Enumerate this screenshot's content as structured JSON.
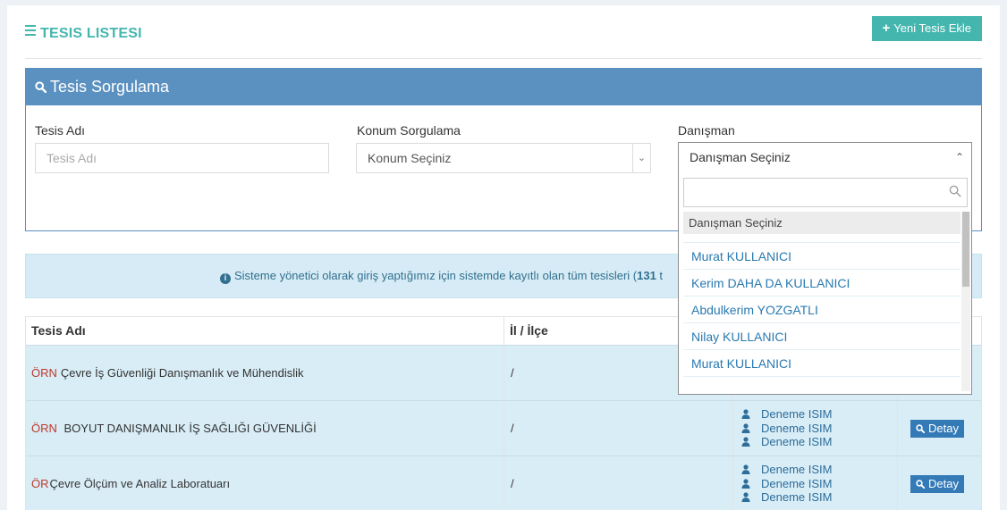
{
  "header": {
    "title": "TESIS LISTESI",
    "add_button": "Yeni Tesis Ekle"
  },
  "search_panel": {
    "title": "Tesis Sorgulama",
    "facility_name_label": "Tesis Adı",
    "facility_name_placeholder": "Tesis Adı",
    "location_label": "Konum Sorgulama",
    "location_value": "Konum Seçiniz",
    "consultant_label": "Danışman",
    "consultant_value": "Danışman Seçiniz"
  },
  "consultant_dropdown": {
    "selected_option": "Danışman Seçiniz",
    "options": [
      "Murat KULLANICI",
      "Kerim DAHA DA KULLANICI",
      "Abdulkerim YOZGATLI",
      "Nilay KULLANICI",
      "Murat KULLANICI"
    ]
  },
  "alert": {
    "text_before": "Sisteme yönetici olarak giriş yaptığımız için sistemde kayıtlı olan tüm tesisleri (",
    "count": "131",
    "text_after": " t"
  },
  "table": {
    "headers": [
      "Tesis Adı",
      "İl / İlçe",
      "",
      ""
    ],
    "rows": [
      {
        "code": "ÖRN",
        "name": "Çevre İş Güvenliği Danışmanlık ve Mühendislik",
        "location": "/",
        "consultants": [],
        "detail": ""
      },
      {
        "code": "ÖRN",
        "name": " BOYUT DANIŞMANLIK İŞ SAĞLIĞI GÜVENLİĞİ",
        "location": "/",
        "consultants": [
          "Deneme ISIM",
          "Deneme ISIM",
          "Deneme ISIM"
        ],
        "detail": "Detay"
      },
      {
        "code": "ÖR",
        "name": "Çevre Ölçüm ve Analiz Laboratuarı",
        "location": "/",
        "consultants": [
          "Deneme ISIM",
          "Deneme ISIM",
          "Deneme ISIM"
        ],
        "detail": "Detay"
      }
    ]
  },
  "colors": {
    "accent": "#44b6ae",
    "panel_header": "#5b91c0",
    "alert_bg": "#d6ebf5",
    "link": "#2a7ab0",
    "code_red": "#c0392b",
    "detail_button": "#337ab7"
  },
  "icons": {
    "title": "bars-icon",
    "add": "plus-icon",
    "panel": "search-icon",
    "alert": "info-circle-icon",
    "consultant": "user-icon",
    "detail": "search-icon"
  }
}
